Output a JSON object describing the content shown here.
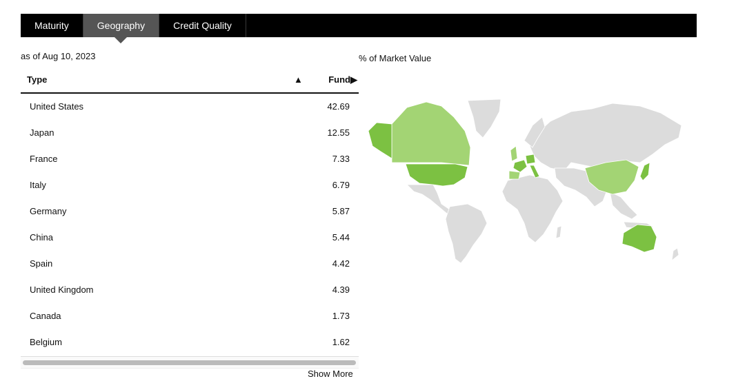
{
  "tabs": [
    {
      "label": "Maturity"
    },
    {
      "label": "Geography"
    },
    {
      "label": "Credit Quality"
    }
  ],
  "as_of": "as of Aug 10, 2023",
  "map_label": "% of Market Value",
  "table": {
    "col_type": "Type",
    "sort_icon": "▲",
    "col_fund": "Fund▶",
    "rows": [
      {
        "name": "United States",
        "value": "42.69"
      },
      {
        "name": "Japan",
        "value": "12.55"
      },
      {
        "name": "France",
        "value": "7.33"
      },
      {
        "name": "Italy",
        "value": "6.79"
      },
      {
        "name": "Germany",
        "value": "5.87"
      },
      {
        "name": "China",
        "value": "5.44"
      },
      {
        "name": "Spain",
        "value": "4.42"
      },
      {
        "name": "United Kingdom",
        "value": "4.39"
      },
      {
        "name": "Canada",
        "value": "1.73"
      },
      {
        "name": "Belgium",
        "value": "1.62"
      }
    ]
  },
  "show_more": "Show More",
  "map_colors": {
    "high": "#7cc142",
    "low": "#a3d474",
    "none": "#dcdcdc"
  }
}
